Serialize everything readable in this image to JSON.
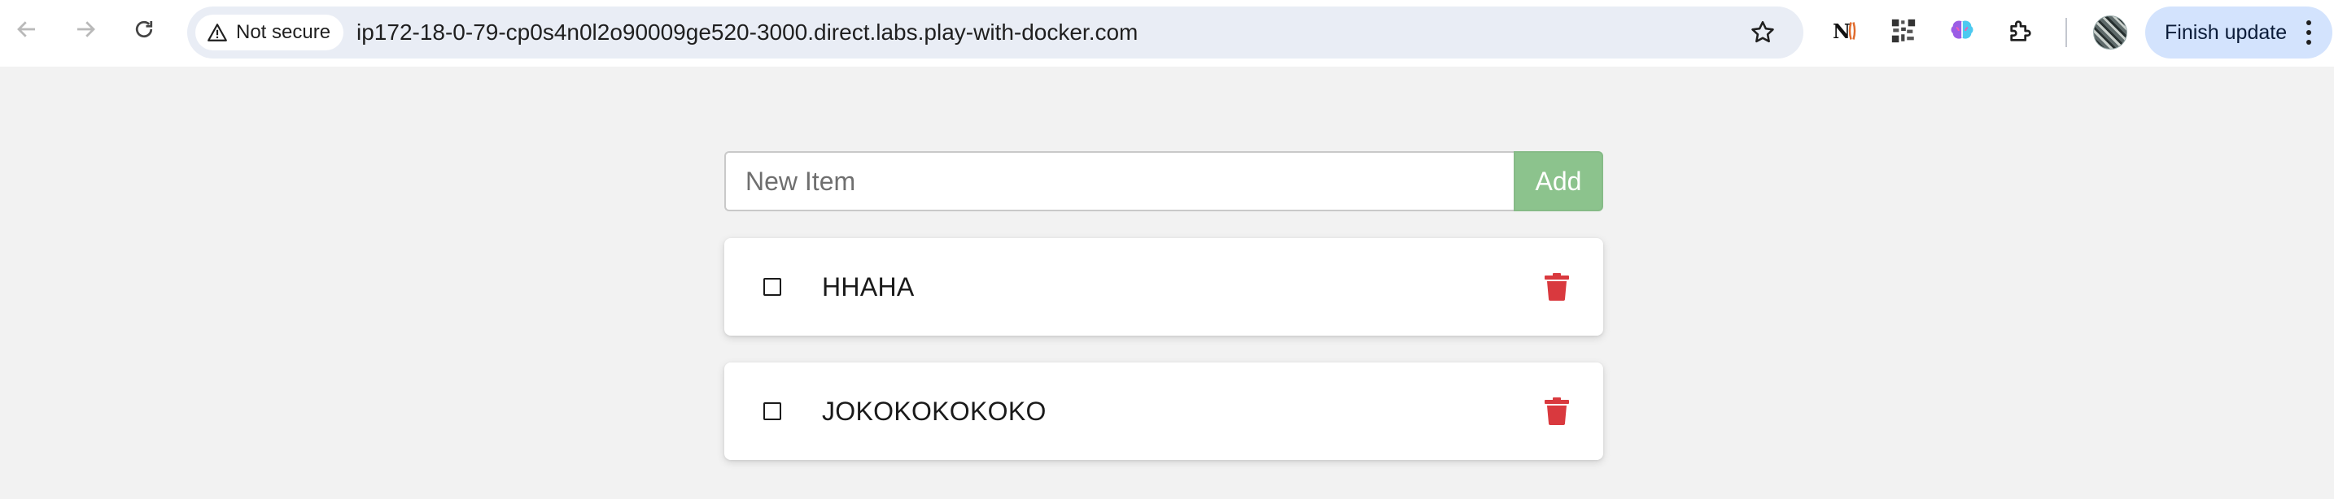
{
  "browser": {
    "security_label": "Not secure",
    "url": "ip172-18-0-79-cp0s4n0l2o90009ge520-3000.direct.labs.play-with-docker.com",
    "update_button": "Finish update",
    "icons": [
      "back-icon",
      "forward-icon",
      "reload-icon",
      "warning-icon",
      "star-icon",
      "notion-extension-icon",
      "qr-extension-icon",
      "brain-extension-icon",
      "extensions-puzzle-icon",
      "profile-avatar",
      "menu-kebab-icon"
    ]
  },
  "app": {
    "new_item_placeholder": "New Item",
    "add_label": "Add",
    "items": [
      {
        "name": "HHAHA",
        "completed": false
      },
      {
        "name": "JOKOKOKOKOKO",
        "completed": false
      }
    ],
    "colors": {
      "add_button": "#8cc38d",
      "delete_icon": "#d9393e",
      "background": "#f2f2f2"
    }
  }
}
